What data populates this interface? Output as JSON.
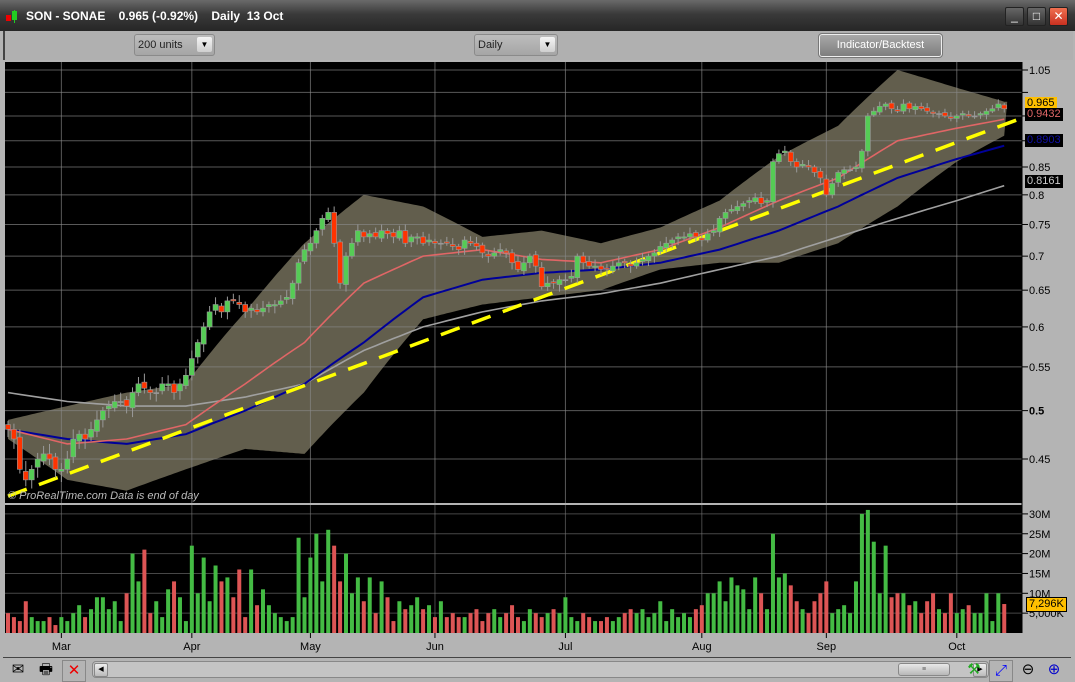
{
  "window": {
    "title": "SON - SONAE    0.965 (-0.92%)    Daily  13 Oct",
    "minimize_label": "_",
    "maximize_label": "□",
    "close_label": "✕"
  },
  "toolbar": {
    "units_select": "200 units",
    "period_select": "Daily",
    "indicator_button": "Indicator/Backtest"
  },
  "watermark": "© ProRealTime.com   Data is end of day",
  "price_tags": {
    "last": {
      "text": "0.965",
      "bg": "#FFC000",
      "fg": "#000000"
    },
    "ma_red": {
      "text": "0.9432",
      "bg": "#000000",
      "fg": "#E06666"
    },
    "ma_blue": {
      "text": "0.8903",
      "bg": "#000000",
      "fg": "#1010AA"
    },
    "ma_gray": {
      "text": "0.8161",
      "bg": "#000000",
      "fg": "#CCCCCC"
    }
  },
  "volume_tag": {
    "text": "7,296K",
    "bg": "#FFC000",
    "fg": "#000000"
  },
  "bottom_icons": [
    "mail-icon",
    "printer-icon",
    "link-disabled-icon",
    "indicator-tool-icon",
    "zoom-fit-icon",
    "zoom-out-icon",
    "zoom-in-icon"
  ],
  "chart_data": [
    {
      "type": "candlestick",
      "scale": "log",
      "ylim": [
        0.41,
        1.06
      ],
      "grid": true,
      "price_ticks": [
        1.05,
        1.0,
        0.95,
        0.9,
        0.85,
        0.8,
        0.75,
        0.7,
        0.65,
        0.6,
        0.55,
        0.5,
        0.45
      ],
      "price_tick_labels": [
        "1.05",
        "",
        "",
        "",
        "0.85",
        "0.8",
        "0.75",
        "0.7",
        "0.65",
        "0.6",
        "0.55",
        "0.5",
        "0.45"
      ],
      "months": [
        {
          "label": "Mar",
          "bar": 9
        },
        {
          "label": "Apr",
          "bar": 31
        },
        {
          "label": "May",
          "bar": 51
        },
        {
          "label": "Jun",
          "bar": 72
        },
        {
          "label": "Jul",
          "bar": 94
        },
        {
          "label": "Aug",
          "bar": 117
        },
        {
          "label": "Sep",
          "bar": 138
        },
        {
          "label": "Oct",
          "bar": 160
        }
      ],
      "close": [
        0.48,
        0.47,
        0.44,
        0.43,
        0.44,
        0.45,
        0.455,
        0.45,
        0.44,
        0.44,
        0.45,
        0.47,
        0.475,
        0.47,
        0.48,
        0.49,
        0.5,
        0.505,
        0.51,
        0.51,
        0.505,
        0.52,
        0.53,
        0.525,
        0.52,
        0.52,
        0.53,
        0.53,
        0.52,
        0.53,
        0.54,
        0.56,
        0.58,
        0.6,
        0.62,
        0.63,
        0.62,
        0.635,
        0.635,
        0.63,
        0.62,
        0.625,
        0.62,
        0.625,
        0.63,
        0.63,
        0.635,
        0.64,
        0.66,
        0.69,
        0.71,
        0.72,
        0.74,
        0.76,
        0.77,
        0.72,
        0.66,
        0.7,
        0.72,
        0.74,
        0.73,
        0.735,
        0.73,
        0.74,
        0.735,
        0.73,
        0.74,
        0.72,
        0.73,
        0.73,
        0.72,
        0.725,
        0.72,
        0.72,
        0.72,
        0.715,
        0.71,
        0.725,
        0.72,
        0.715,
        0.705,
        0.7,
        0.705,
        0.71,
        0.705,
        0.69,
        0.68,
        0.69,
        0.7,
        0.685,
        0.655,
        0.66,
        0.66,
        0.665,
        0.665,
        0.67,
        0.7,
        0.69,
        0.685,
        0.685,
        0.68,
        0.68,
        0.685,
        0.69,
        0.69,
        0.685,
        0.69,
        0.695,
        0.7,
        0.705,
        0.715,
        0.72,
        0.725,
        0.73,
        0.73,
        0.735,
        0.73,
        0.725,
        0.735,
        0.74,
        0.76,
        0.77,
        0.775,
        0.78,
        0.785,
        0.79,
        0.795,
        0.785,
        0.79,
        0.86,
        0.875,
        0.88,
        0.86,
        0.85,
        0.855,
        0.85,
        0.84,
        0.83,
        0.8,
        0.82,
        0.84,
        0.845,
        0.845,
        0.85,
        0.88,
        0.95,
        0.96,
        0.97,
        0.975,
        0.965,
        0.96,
        0.975,
        0.965,
        0.97,
        0.965,
        0.96,
        0.955,
        0.955,
        0.95,
        0.945,
        0.95,
        0.955,
        0.95,
        0.95,
        0.955,
        0.96,
        0.965,
        0.975,
        0.965
      ],
      "overlays": {
        "ma_red": {
          "color": "#E06666",
          "points": [
            [
              0,
              0.48
            ],
            [
              10,
              0.465
            ],
            [
              20,
              0.47
            ],
            [
              30,
              0.485
            ],
            [
              40,
              0.53
            ],
            [
              50,
              0.58
            ],
            [
              60,
              0.66
            ],
            [
              70,
              0.7
            ],
            [
              80,
              0.71
            ],
            [
              90,
              0.695
            ],
            [
              100,
              0.69
            ],
            [
              110,
              0.71
            ],
            [
              120,
              0.745
            ],
            [
              130,
              0.79
            ],
            [
              140,
              0.83
            ],
            [
              150,
              0.9
            ],
            [
              160,
              0.925
            ],
            [
              168,
              0.9432
            ]
          ]
        },
        "ma_blue": {
          "color": "#000099",
          "points": [
            [
              0,
              0.48
            ],
            [
              10,
              0.47
            ],
            [
              20,
              0.465
            ],
            [
              30,
              0.475
            ],
            [
              40,
              0.5
            ],
            [
              50,
              0.53
            ],
            [
              60,
              0.58
            ],
            [
              70,
              0.64
            ],
            [
              80,
              0.665
            ],
            [
              90,
              0.675
            ],
            [
              100,
              0.68
            ],
            [
              110,
              0.69
            ],
            [
              120,
              0.71
            ],
            [
              130,
              0.74
            ],
            [
              140,
              0.78
            ],
            [
              150,
              0.83
            ],
            [
              160,
              0.865
            ],
            [
              168,
              0.8903
            ]
          ]
        },
        "ma_gray": {
          "color": "#A0A0A0",
          "points": [
            [
              0,
              0.52
            ],
            [
              10,
              0.51
            ],
            [
              20,
              0.505
            ],
            [
              30,
              0.505
            ],
            [
              40,
              0.515
            ],
            [
              50,
              0.53
            ],
            [
              60,
              0.57
            ],
            [
              70,
              0.6
            ],
            [
              80,
              0.62
            ],
            [
              90,
              0.635
            ],
            [
              100,
              0.645
            ],
            [
              110,
              0.66
            ],
            [
              120,
              0.68
            ],
            [
              130,
              0.7
            ],
            [
              140,
              0.73
            ],
            [
              150,
              0.76
            ],
            [
              160,
              0.79
            ],
            [
              168,
              0.8161
            ]
          ]
        },
        "band_upper": [
          [
            0,
            0.49
          ],
          [
            10,
            0.505
          ],
          [
            20,
            0.52
          ],
          [
            30,
            0.53
          ],
          [
            40,
            0.62
          ],
          [
            50,
            0.72
          ],
          [
            60,
            0.8
          ],
          [
            70,
            0.78
          ],
          [
            80,
            0.73
          ],
          [
            90,
            0.74
          ],
          [
            100,
            0.72
          ],
          [
            110,
            0.745
          ],
          [
            120,
            0.79
          ],
          [
            130,
            0.87
          ],
          [
            140,
            0.93
          ],
          [
            150,
            1.05
          ],
          [
            160,
            1.01
          ],
          [
            168,
            0.98
          ]
        ],
        "band_lower": [
          [
            0,
            0.47
          ],
          [
            10,
            0.43
          ],
          [
            20,
            0.42
          ],
          [
            30,
            0.44
          ],
          [
            40,
            0.46
          ],
          [
            50,
            0.455
          ],
          [
            60,
            0.52
          ],
          [
            70,
            0.61
          ],
          [
            80,
            0.63
          ],
          [
            90,
            0.64
          ],
          [
            100,
            0.65
          ],
          [
            110,
            0.68
          ],
          [
            120,
            0.69
          ],
          [
            130,
            0.69
          ],
          [
            140,
            0.72
          ],
          [
            150,
            0.78
          ],
          [
            160,
            0.86
          ],
          [
            168,
            0.91
          ]
        ],
        "band_color": "#625E4D",
        "trendline": {
          "color": "#FFFF00",
          "style": "dashed",
          "points": [
            [
              0,
              0.415
            ],
            [
              171,
              0.945
            ]
          ]
        }
      }
    },
    {
      "type": "bar",
      "ylabel": "Volume",
      "ylim": [
        0,
        30000000
      ],
      "ticks": [
        "30M",
        "25M",
        "20M",
        "15M",
        "10M",
        "5,000K"
      ],
      "tick_values": [
        30,
        25,
        20,
        15,
        10,
        5
      ],
      "unit": "M",
      "up_color": "#44BB44",
      "down_color": "#DD5555",
      "values": [
        5,
        4,
        3,
        8,
        4,
        3,
        3,
        4,
        2,
        4,
        3,
        5,
        7,
        4,
        6,
        9,
        9,
        6,
        8,
        3,
        10,
        20,
        13,
        21,
        5,
        8,
        4,
        11,
        13,
        9,
        3,
        22,
        10,
        19,
        8,
        17,
        13,
        14,
        9,
        16,
        4,
        16,
        7,
        11,
        7,
        5,
        4,
        3,
        4,
        24,
        9,
        19,
        25,
        13,
        26,
        22,
        13,
        20,
        10,
        14,
        8,
        14,
        5,
        13,
        9,
        3,
        8,
        6,
        7,
        9,
        6,
        7,
        4,
        8,
        4,
        5,
        4,
        4,
        5,
        6,
        3,
        5,
        6,
        4,
        5,
        7,
        4,
        3,
        6,
        5,
        4,
        5,
        6,
        5,
        9,
        4,
        3,
        5,
        4,
        3,
        3,
        4,
        3,
        4,
        5,
        6,
        5,
        6,
        4,
        5,
        8,
        3,
        6,
        4,
        5,
        4,
        6,
        7,
        10,
        10,
        13,
        8,
        14,
        12,
        11,
        6,
        14,
        10,
        6,
        25,
        14,
        15,
        12,
        8,
        6,
        5,
        8,
        10,
        13,
        5,
        6,
        7,
        5,
        13,
        30,
        31,
        23,
        10,
        22,
        9,
        10,
        10,
        7,
        8,
        5,
        8,
        10,
        6,
        5,
        10,
        5,
        6,
        7,
        5,
        5,
        10,
        3,
        10,
        7.296
      ]
    }
  ]
}
